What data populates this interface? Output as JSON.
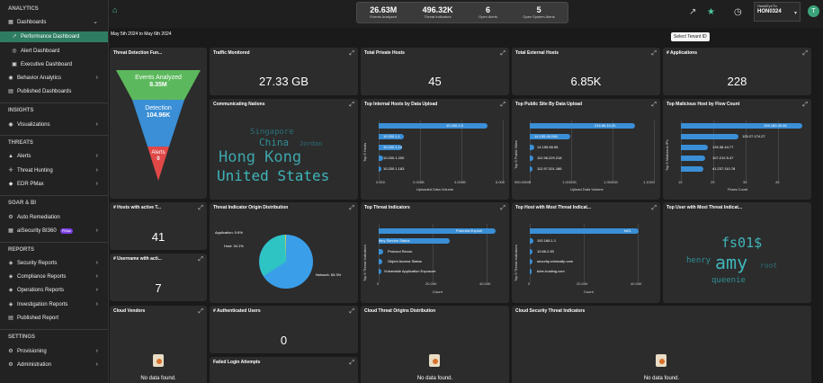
{
  "sidebar": {
    "analytics": "ANALYTICS",
    "dashboards": "Dashboards",
    "performance": "Performance Dashboard",
    "alert": "Alert Dashboard",
    "executive": "Executive Dashboard",
    "behavior": "Behavior Analytics",
    "published": "Published Dashboards",
    "insights": "INSIGHTS",
    "visualizations": "Visualizations",
    "threats": "THREATS",
    "alerts": "Alerts",
    "hunting": "Threat Hunting",
    "edr": "EDR PMax",
    "soar": "SOAR & BI",
    "auto": "Auto Remediation",
    "bi360": "aiSecurity BI360",
    "bi_tag": "PMax",
    "reports": "REPORTS",
    "sec_reports": "Security Reports",
    "comp_reports": "Compliance Reports",
    "ops_reports": "Operations Reports",
    "inv_reports": "Investigation Reports",
    "pub_report": "Published Report",
    "settings": "SETTINGS",
    "provisioning": "Provisioning",
    "administration": "Administration"
  },
  "header": {
    "stats": [
      {
        "value": "26.63M",
        "label": "Events Analyzed"
      },
      {
        "value": "496.32K",
        "label": "Threat Indicators"
      },
      {
        "value": "6",
        "label": "Open Alerts"
      },
      {
        "value": "5",
        "label": "Open System Alerts"
      }
    ],
    "tenant_label": "HawkEyeTix",
    "tenant_value": "HON0324",
    "avatar": "T",
    "tooltip": "Select Tenant ID"
  },
  "date_range": "May 5th 2024 to May 6th 2024",
  "cards": {
    "funnel": {
      "title": "Threat Detection Fun...",
      "items": [
        {
          "label": "Events Analyzed",
          "value": "8.35M",
          "color": "#5cb85c"
        },
        {
          "label": "Detection",
          "value": "104.96K",
          "color": "#3a8fd6"
        },
        {
          "label": "Alerts",
          "value": "0",
          "color": "#e04848"
        }
      ]
    },
    "traffic": {
      "title": "Traffic Monitored",
      "value": "27.33 GB"
    },
    "private": {
      "title": "Total Private Hosts",
      "value": "45"
    },
    "external": {
      "title": "Total External Hosts",
      "value": "6.85K"
    },
    "apps": {
      "title": "# Applications",
      "value": "228"
    },
    "nations": {
      "title": "Communicating Nations",
      "words": [
        "Singapore",
        "China",
        "Jordan",
        "Hong Kong",
        "United States"
      ]
    },
    "internal_upload": {
      "title": "Top Internal Hosts by Data Upload",
      "ylabel": "Top 5 Hosts",
      "xlabel": "Uploaded Data Volume",
      "ticks": [
        "0.000",
        "2.000B",
        "4.000B",
        "6.000"
      ],
      "rows": [
        "10.200.1.5",
        "10.200.1.1",
        "10.200.1.10",
        "10.200.1.200",
        "10.200.1.183"
      ]
    },
    "public_site": {
      "title": "Top Public Site By Data Upload",
      "ylabel": "Top 5 Public Sites",
      "xlabel": "Upload Data Volume",
      "ticks": [
        "950.00MB",
        "1.000GB",
        "1.050GB",
        "1.100G"
      ],
      "rows": [
        "216.66.10.20",
        "14.155.46.248",
        "14.155.56.55",
        "112.96.229.218",
        "112.97.201.186"
      ]
    },
    "malicious": {
      "title": "Top Malicious Host by Flow Count",
      "ylabel": "Top 5 Malicious IPs",
      "xlabel": "Flows Count",
      "ticks": [
        "10",
        "20",
        "30",
        "40"
      ],
      "rows": [
        "194.180.49.46",
        "125.27.174.27",
        "126.36.44.77",
        "107.212.5.47",
        "41.237.110.78"
      ]
    },
    "active_threats": {
      "title": "# Hosts with active T...",
      "value": "41"
    },
    "origin": {
      "title": "Threat Indicator Origin Distribution",
      "labels": [
        "Application: 0.6%",
        "Host: 34.1%",
        "Network: 65.3%"
      ]
    },
    "indicators": {
      "title": "Top Threat Indicators",
      "ylabel": "Top 5 Threat Indicators",
      "xlabel": "Count",
      "ticks": [
        "0",
        "20.00K",
        "40.00K"
      ],
      "rows": [
        "Potential Exploit",
        "itory Service Status",
        "Protocol Recon",
        "Object Access Status",
        "Vulnerable Application Exposure"
      ]
    },
    "host_threat": {
      "title": "Top Host with Most Threat Indicat...",
      "ylabel": "Top 5 Threat Indicators",
      "xlabel": "Count",
      "ticks": [
        "0",
        "20.00K",
        "40.00K"
      ],
      "rows": [
        "fs01",
        "192.168.1.1",
        "10.66.2.50",
        "security.criminalip.com",
        "tube-hosting.com"
      ]
    },
    "user_threat": {
      "title": "Top User with Most Threat Indicat...",
      "words": [
        "fs01$",
        "henry",
        "amy",
        "root",
        "queenie"
      ]
    },
    "username": {
      "title": "# Username with acti...",
      "value": "7"
    },
    "cloud_vendors": {
      "title": "Cloud Vendors",
      "nodata": "No data found."
    },
    "auth_users": {
      "title": "# Authenticated Users",
      "value": "0"
    },
    "failed_login": {
      "title": "Failed Login Attempts"
    },
    "cloud_origins": {
      "title": "Cloud Threat Origins Distribution",
      "nodata": "No data found."
    },
    "cloud_sec": {
      "title": "Cloud Security Threat Indicators",
      "nodata": "No data found."
    }
  }
}
